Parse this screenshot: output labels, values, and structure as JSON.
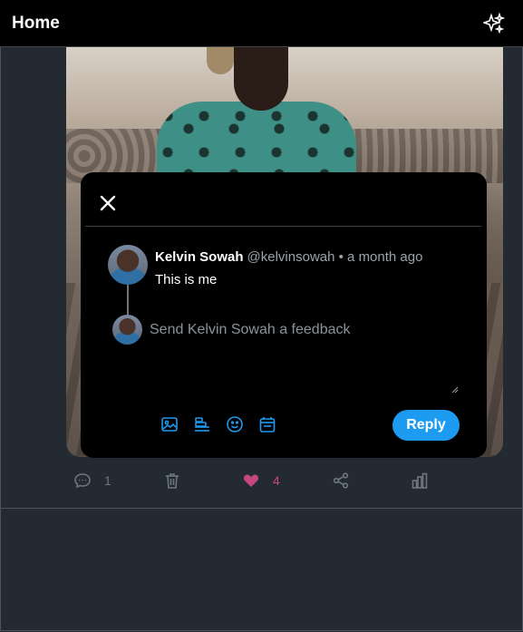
{
  "header": {
    "title": "Home",
    "icon": "sparkle-icon"
  },
  "post": {
    "image_alt": "Photo of a man in a teal palm-print shirt",
    "actions": {
      "comments_count": "1",
      "likes_count": "4",
      "liked": true,
      "like_color": "#c84680",
      "icon_color": "#6e7780"
    }
  },
  "modal": {
    "author_name": "Kelvin Sowah",
    "author_meta": "@kelvinsowah • a month ago",
    "post_text": "This is me",
    "reply_placeholder": "Send Kelvin Sowah a feedback",
    "reply_label": "Reply",
    "tools": [
      "image-icon",
      "poll-icon",
      "emoji-icon",
      "schedule-icon"
    ],
    "accent": "#1d9bf0"
  }
}
